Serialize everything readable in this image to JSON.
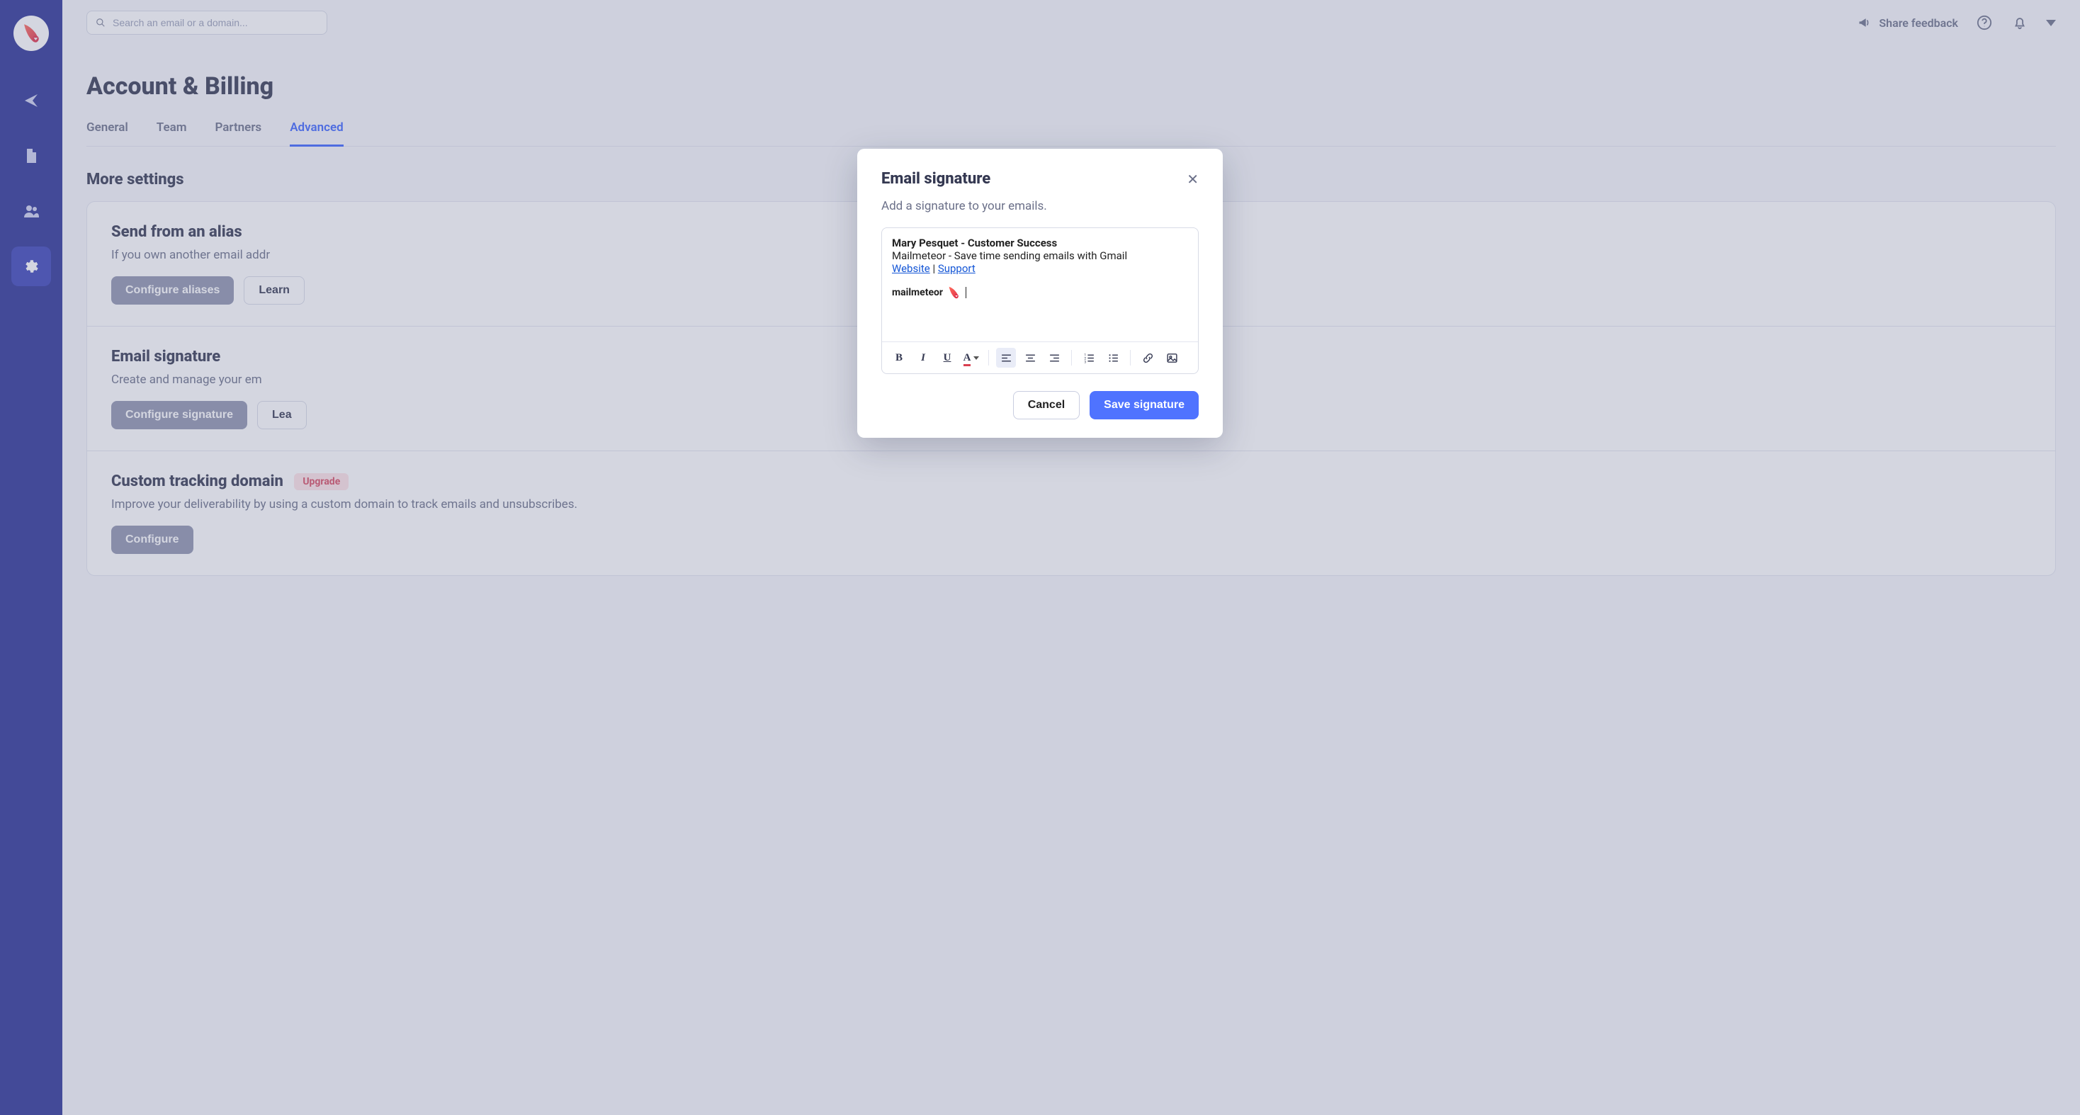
{
  "search": {
    "placeholder": "Search an email or a domain..."
  },
  "topbar": {
    "share_feedback": "Share feedback"
  },
  "page": {
    "title": "Account & Billing"
  },
  "tabs": {
    "general": "General",
    "team": "Team",
    "partners": "Partners",
    "advanced": "Advanced"
  },
  "more_settings": {
    "heading": "More settings"
  },
  "cards": {
    "alias": {
      "title": "Send from an alias",
      "desc": "If you own another email addr",
      "configure": "Configure aliases",
      "learn": "Learn"
    },
    "signature": {
      "title": "Email signature",
      "desc": "Create and manage your em",
      "configure": "Configure signature",
      "learn": "Lea"
    },
    "tracking": {
      "title": "Custom tracking domain",
      "badge": "Upgrade",
      "desc": "Improve your deliverability by using a custom domain to track emails and unsubscribes.",
      "configure": "Configure"
    }
  },
  "modal": {
    "title": "Email signature",
    "subtitle": "Add a signature to your emails.",
    "sig_name": "Mary Pesquet - Customer Success",
    "sig_tagline": "Mailmeteor - Save time sending emails with Gmail",
    "link_website": "Website",
    "sep": " | ",
    "link_support": "Support",
    "sig_brand": "mailmeteor",
    "cancel": "Cancel",
    "save": "Save signature"
  },
  "colors": {
    "primary": "#4f73ff",
    "sidebar": "#2a3295",
    "text": "#343851",
    "muted": "#6b7089"
  }
}
